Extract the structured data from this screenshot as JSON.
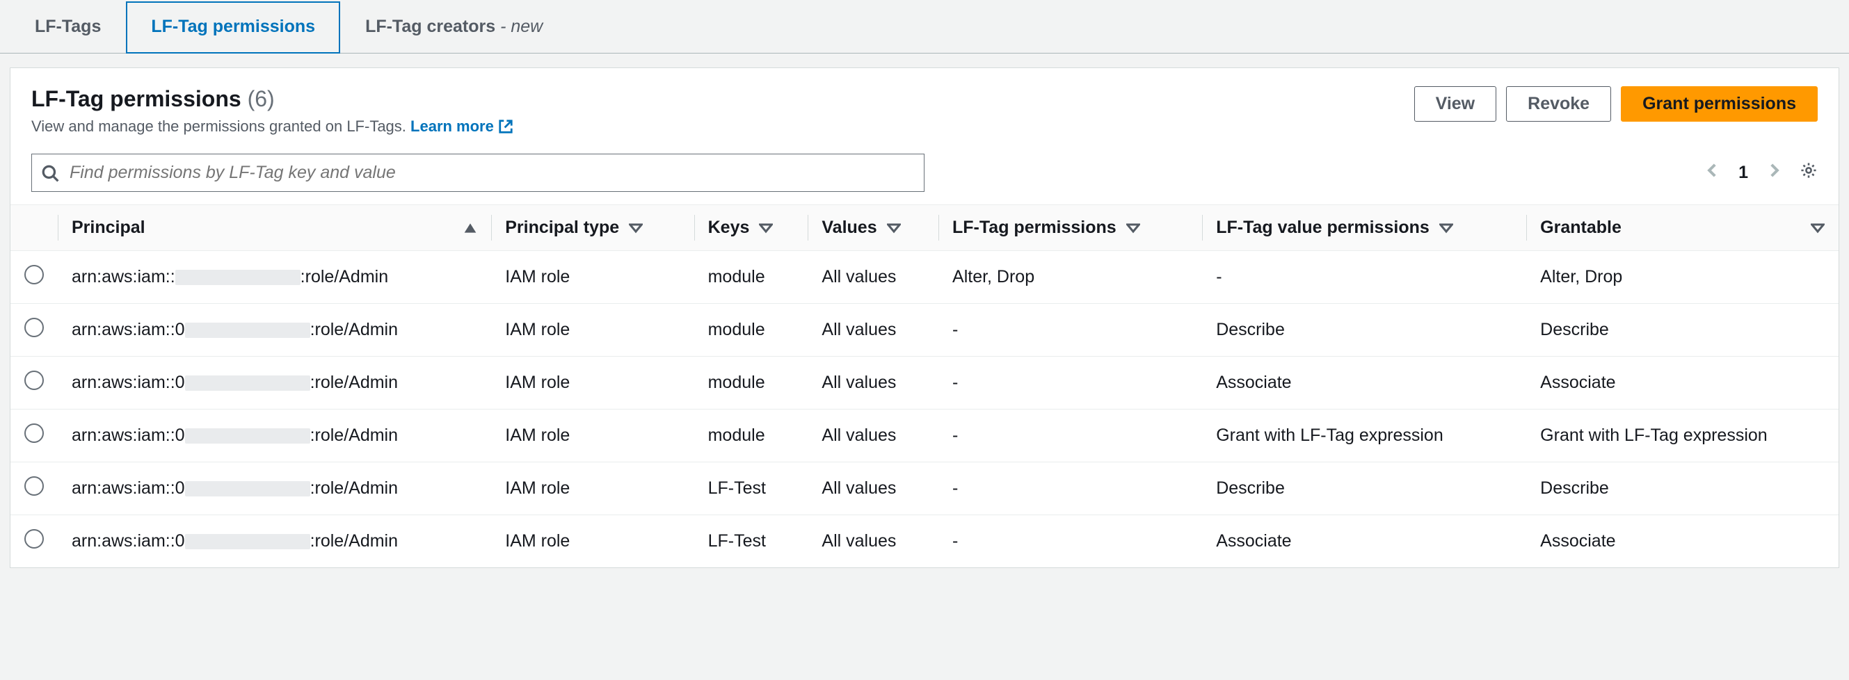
{
  "tabs": [
    {
      "label": "LF-Tags"
    },
    {
      "label": "LF-Tag permissions",
      "active": true
    },
    {
      "label": "LF-Tag creators",
      "suffix": "- new"
    }
  ],
  "header": {
    "title": "LF-Tag permissions",
    "count": "(6)",
    "description": "View and manage the permissions granted on LF-Tags.",
    "learn_more": "Learn more"
  },
  "actions": {
    "view": "View",
    "revoke": "Revoke",
    "grant": "Grant permissions"
  },
  "search": {
    "placeholder": "Find permissions by LF-Tag key and value"
  },
  "pagination": {
    "page": "1"
  },
  "columns": {
    "principal": "Principal",
    "principal_type": "Principal type",
    "keys": "Keys",
    "values": "Values",
    "lf_tag_permissions": "LF-Tag permissions",
    "lf_tag_value_permissions": "LF-Tag value permissions",
    "grantable": "Grantable"
  },
  "rows": [
    {
      "principal_prefix": "arn:aws:iam::",
      "principal_suffix": ":role/Admin",
      "principal_type": "IAM role",
      "keys": "module",
      "values": "All values",
      "lf_tag_permissions": "Alter, Drop",
      "lf_tag_value_permissions": "-",
      "grantable": "Alter, Drop"
    },
    {
      "principal_prefix": "arn:aws:iam::0",
      "principal_suffix": ":role/Admin",
      "principal_type": "IAM role",
      "keys": "module",
      "values": "All values",
      "lf_tag_permissions": "-",
      "lf_tag_value_permissions": "Describe",
      "grantable": "Describe"
    },
    {
      "principal_prefix": "arn:aws:iam::0",
      "principal_suffix": ":role/Admin",
      "principal_type": "IAM role",
      "keys": "module",
      "values": "All values",
      "lf_tag_permissions": "-",
      "lf_tag_value_permissions": "Associate",
      "grantable": "Associate"
    },
    {
      "principal_prefix": "arn:aws:iam::0",
      "principal_suffix": ":role/Admin",
      "principal_type": "IAM role",
      "keys": "module",
      "values": "All values",
      "lf_tag_permissions": "-",
      "lf_tag_value_permissions": "Grant with LF-Tag expression",
      "grantable": "Grant with LF-Tag expression"
    },
    {
      "principal_prefix": "arn:aws:iam::0",
      "principal_suffix": ":role/Admin",
      "principal_type": "IAM role",
      "keys": "LF-Test",
      "values": "All values",
      "lf_tag_permissions": "-",
      "lf_tag_value_permissions": "Describe",
      "grantable": "Describe"
    },
    {
      "principal_prefix": "arn:aws:iam::0",
      "principal_suffix": ":role/Admin",
      "principal_type": "IAM role",
      "keys": "LF-Test",
      "values": "All values",
      "lf_tag_permissions": "-",
      "lf_tag_value_permissions": "Associate",
      "grantable": "Associate"
    }
  ]
}
